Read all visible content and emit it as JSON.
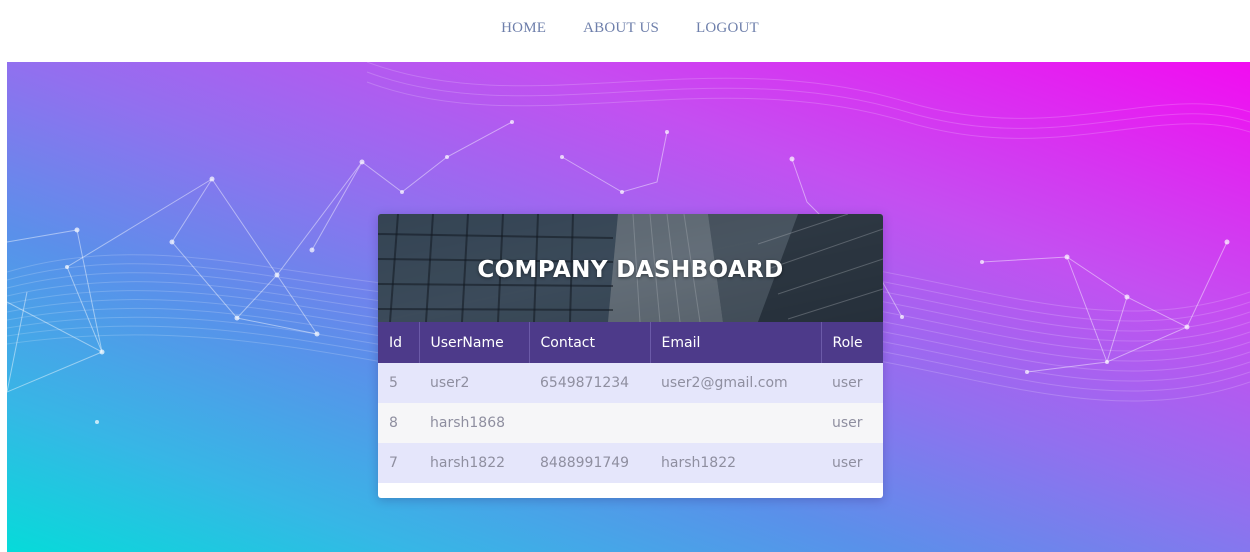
{
  "nav": {
    "items": [
      {
        "label": "HOME"
      },
      {
        "label": "ABOUT US"
      },
      {
        "label": "LOGOUT"
      }
    ]
  },
  "dashboard": {
    "title": "COMPANY DASHBOARD",
    "columns": [
      "Id",
      "UserName",
      "Contact",
      "Email",
      "Role"
    ],
    "rows": [
      {
        "id": "5",
        "username": "user2",
        "contact": "6549871234",
        "email": "user2@gmail.com",
        "role": "user"
      },
      {
        "id": "8",
        "username": "harsh1868",
        "contact": "",
        "email": "",
        "role": "user"
      },
      {
        "id": "7",
        "username": "harsh1822",
        "contact": "8488991749",
        "email": "harsh1822",
        "role": "user"
      }
    ]
  },
  "colors": {
    "header_bg": "#4d3a8a",
    "row_odd": "#e5e6fb",
    "row_even": "#f6f6f8",
    "nav_text": "#6e7fab",
    "gradient_start": "#06dbd9",
    "gradient_end": "#f20cf1"
  }
}
